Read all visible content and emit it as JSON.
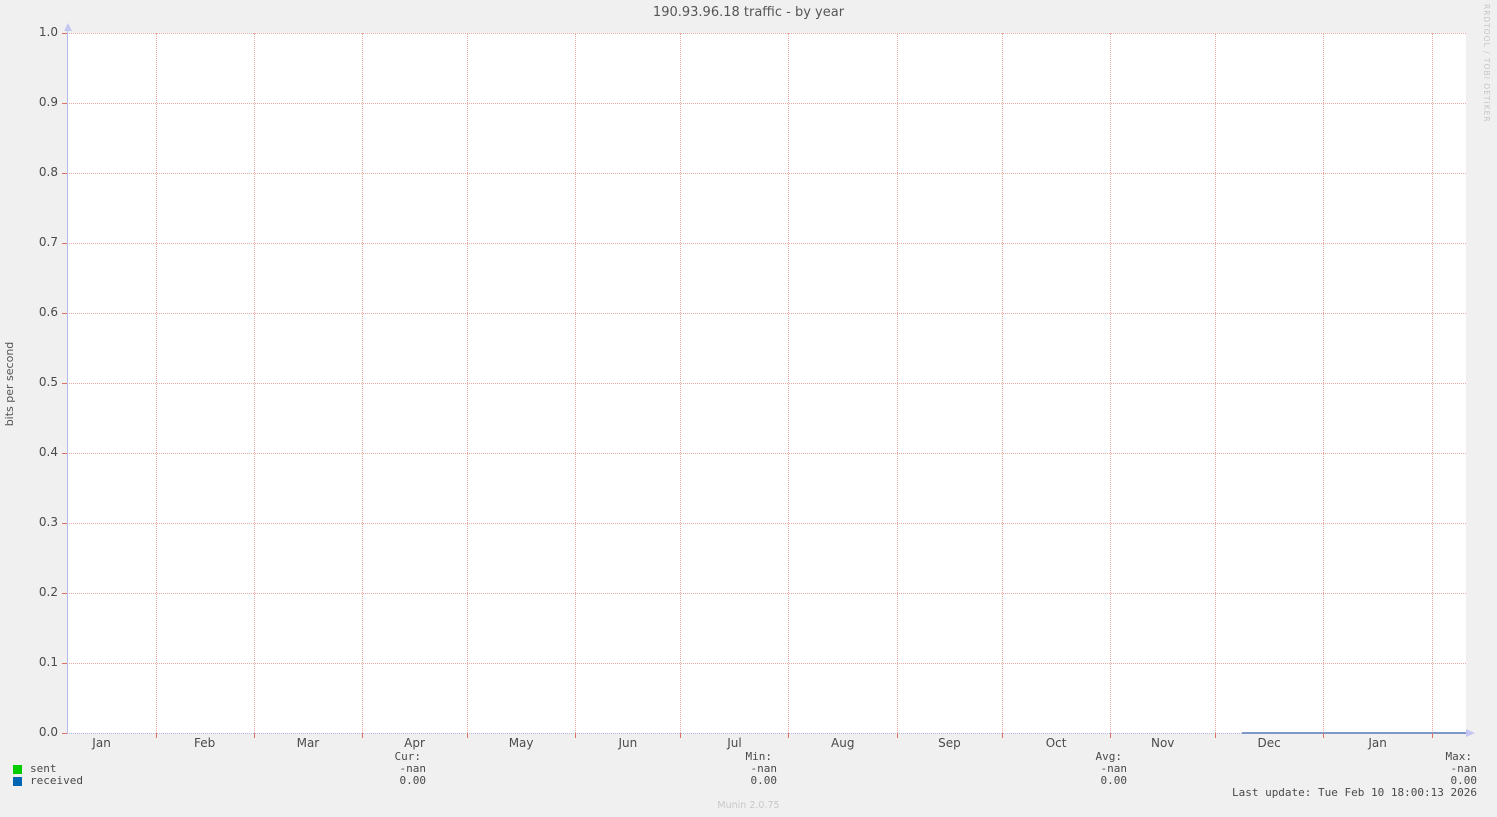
{
  "title": "190.93.96.18 traffic - by year",
  "watermark": "RRDTOOL / TOBI OETIKER",
  "footer": {
    "last_update": "Last update: Tue Feb 10 18:00:13 2026",
    "generator": "Munin 2.0.75"
  },
  "chart_data": {
    "type": "line",
    "title": "190.93.96.18 traffic - by year",
    "xlabel": "",
    "ylabel": "bits per second",
    "ylim": [
      0.0,
      1.0
    ],
    "grid": true,
    "y_ticks": [
      "0.0",
      "0.1",
      "0.2",
      "0.3",
      "0.4",
      "0.5",
      "0.6",
      "0.7",
      "0.8",
      "0.9",
      "1.0"
    ],
    "x_tick_labels": [
      "Jan",
      "Feb",
      "Mar",
      "Apr",
      "May",
      "Jun",
      "Jul",
      "Aug",
      "Sep",
      "Oct",
      "Nov",
      "Dec",
      "Jan"
    ],
    "x_label_fracs": [
      0.0247,
      0.0984,
      0.1722,
      0.2484,
      0.3246,
      0.4009,
      0.4771,
      0.5545,
      0.6308,
      0.707,
      0.7832,
      0.8593,
      0.9368
    ],
    "x_grid_fracs": [
      0.0634,
      0.1334,
      0.2109,
      0.2858,
      0.3633,
      0.4383,
      0.5157,
      0.5932,
      0.6682,
      0.7457,
      0.8206,
      0.8981,
      0.9756
    ],
    "legend_position": "bottom-left",
    "series": [
      {
        "name": "sent",
        "color": "#00cc00",
        "values": []
      },
      {
        "name": "received",
        "color": "#0066b3",
        "line_render_color": "#7e98c8",
        "values": [
          {
            "x_frac_start": 0.84,
            "x_frac_end": 1.0,
            "y": 0.0
          }
        ]
      }
    ],
    "stats": {
      "columns": [
        {
          "label": "Cur:",
          "sent": "-nan",
          "received": "0.00"
        },
        {
          "label": "Min:",
          "sent": "-nan",
          "received": "0.00"
        },
        {
          "label": "Avg:",
          "sent": "-nan",
          "received": "0.00"
        },
        {
          "label": "Max:",
          "sent": "-nan",
          "received": "0.00"
        }
      ]
    }
  }
}
